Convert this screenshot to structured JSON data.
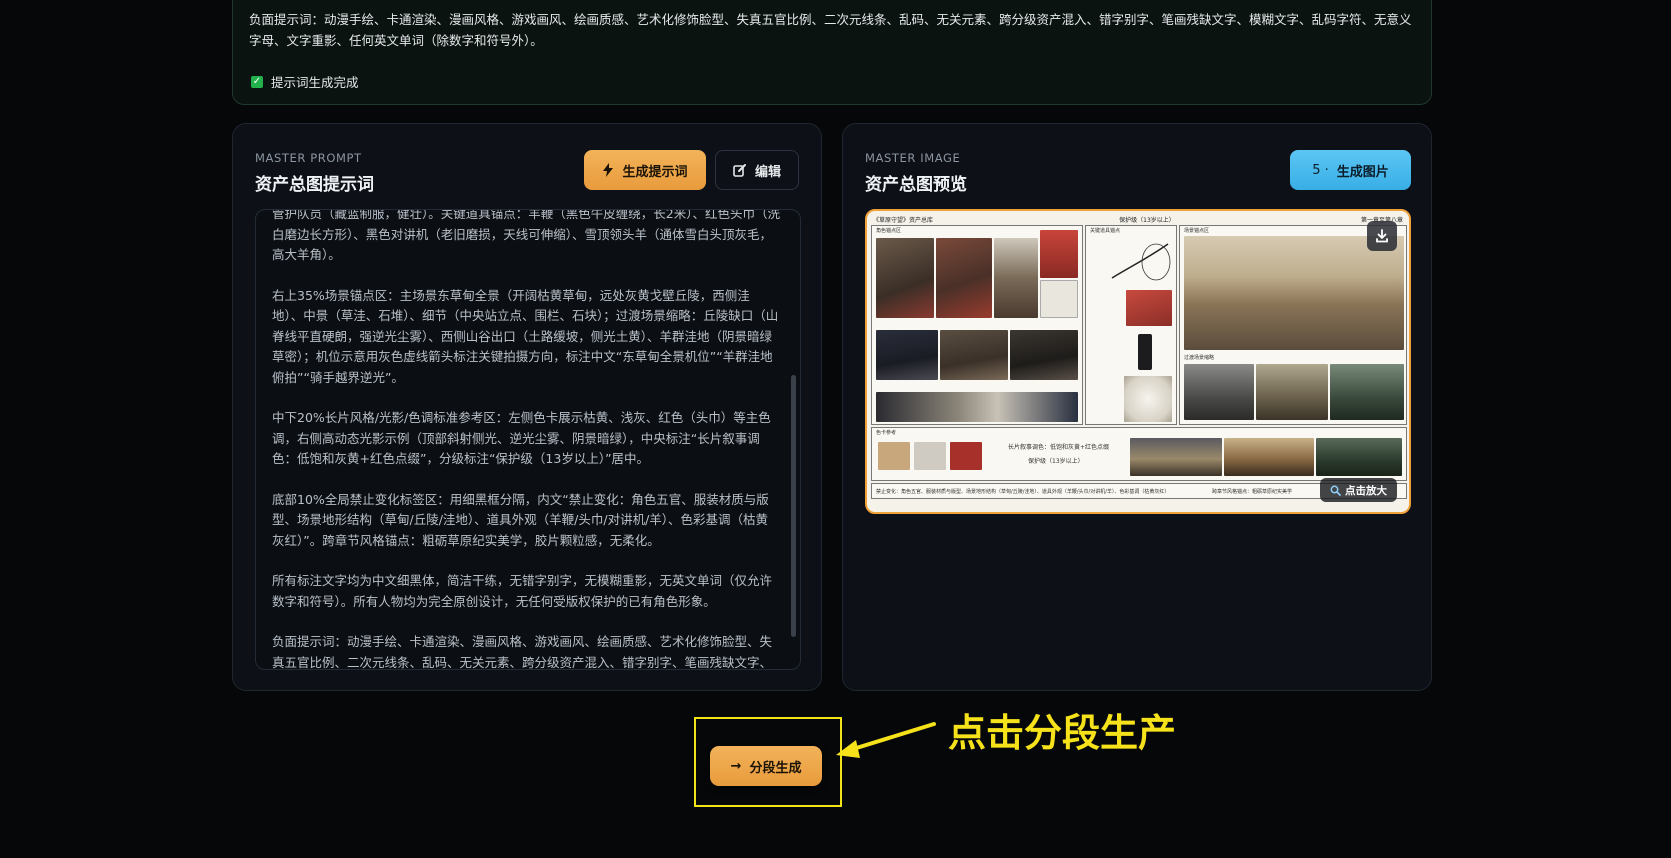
{
  "top_card": {
    "negative_prompt": "负面提示词：动漫手绘、卡通渲染、漫画风格、游戏画风、绘画质感、艺术化修饰脸型、失真五官比例、二次元线条、乱码、无关元素、跨分级资产混入、错字别字、笔画残缺文字、模糊文字、乱码字符、无意义字母、文字重影、任何英文单词（除数字和符号外）。",
    "done_label": "提示词生成完成"
  },
  "left_panel": {
    "eyebrow": "MASTER PROMPT",
    "title": "资产总图提示词",
    "generate_button": "生成提示词",
    "edit_button": "编辑",
    "prompt_paragraphs": [
      "管护队员（藏蓝制服，健壮）。关键道具锚点：羊鞭（黑色牛皮缠绕，长2米）、红色头巾（洗白磨边长方形）、黑色对讲机（老旧磨损，天线可伸缩）、雪顶领头羊（通体雪白头顶灰毛，高大羊角）。",
      "右上35%场景锚点区：主场景东草甸全景（开阔枯黄草甸，远处灰黄戈壁丘陵，西侧洼地）、中景（草洼、石堆）、细节（中央站立点、围栏、石块）；过渡场景缩略：丘陵缺口（山脊线平直硬朗，强逆光尘雾）、西侧山谷出口（土路缓坡，侧光土黄）、羊群洼地（阴景暗绿草密）；机位示意用灰色虚线箭头标注关键拍摄方向，标注中文“东草甸全景机位”“羊群洼地俯拍”“骑手越界逆光”。",
      "中下20%长片风格/光影/色调标准参考区：左侧色卡展示枯黄、浅灰、红色（头巾）等主色调，右侧高动态光影示例（顶部斜射侧光、逆光尘雾、阴景暗绿），中央标注“长片叙事调色：低饱和灰黄+红色点缀”，分级标注“保护级（13岁以上）”居中。",
      "底部10%全局禁止变化标签区：用细黑框分隔，内文“禁止变化：角色五官、服装材质与版型、场景地形结构（草甸/丘陵/洼地）、道具外观（羊鞭/头巾/对讲机/羊）、色彩基调（枯黄灰红）”。跨章节风格锚点：粗砺草原纪实美学，胶片颗粒感，无柔化。",
      "所有标注文字均为中文细黑体，简洁干练，无错字别字，无模糊重影，无英文单词（仅允许数字和符号）。所有人物均为完全原创设计，无任何受版权保护的已有角色形象。",
      "负面提示词：动漫手绘、卡通渲染、漫画风格、游戏画风、绘画质感、艺术化修饰脸型、失真五官比例、二次元线条、乱码、无关元素、跨分级资产混入、错字别字、笔画残缺文字、模糊文字"
    ]
  },
  "right_panel": {
    "eyebrow": "MASTER IMAGE",
    "title": "资产总图预览",
    "generate_button_count": "5 ·",
    "generate_button_label": "生成图片",
    "zoom_label": "点击放大",
    "sheet": {
      "header_left": "《草原守望》资产总库",
      "header_center": "保护级（13岁以上）",
      "header_right": "第一章至第八章",
      "section_characters": "角色锚点区",
      "section_props": "关键道具锚点",
      "section_scenes": "场景锚点区",
      "section_transitions": "过渡场景缩略",
      "section_colors": "色卡参考",
      "tone_note": "长片叙事调色：低饱和灰黄+红色点缀",
      "rating_note": "保护级（13岁以上）",
      "forbidden_note": "禁止变化：角色五官、服装材质与版型、场景地形结构（草甸/丘陵/洼地）、道具外观（羊鞭/头巾/对讲机/羊）、色彩基调（枯黄灰红）",
      "cross_chapter_note": "跨章节风格锚点：粗砺草原纪实美学"
    }
  },
  "cta": {
    "arrow_glyph": "→",
    "segment_button": "分段生成"
  },
  "annotation": {
    "text": "点击分段生产",
    "color": "#f5e21a"
  },
  "colors": {
    "accent_orange": "#e89b3c",
    "accent_blue": "#38aee6",
    "success_green": "#22b14c"
  }
}
